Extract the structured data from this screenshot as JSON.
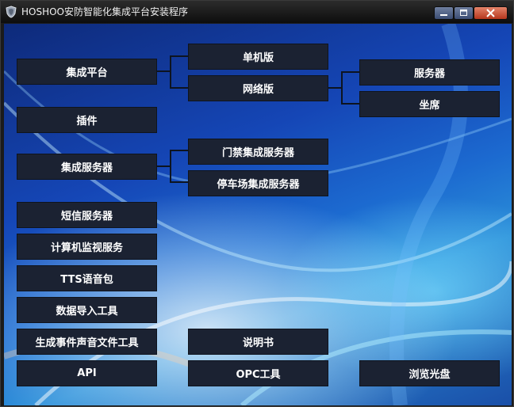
{
  "window": {
    "title": "HOSHOO安防智能化集成平台安装程序",
    "icon": "shield-icon"
  },
  "titlebar_buttons": [
    "minimize-icon",
    "maximize-icon",
    "close-icon"
  ],
  "buttons": {
    "jicheng_pingtai": "集成平台",
    "danjiban": "单机版",
    "wangluoban": "网络版",
    "fuwuqi": "服务器",
    "zuoxi": "坐席",
    "chajian": "插件",
    "jicheng_fuwuqi": "集成服务器",
    "menjin": "门禁集成服务器",
    "tingchechang": "停车场集成服务器",
    "duanxin": "短信服务器",
    "jisuanji_jianshi": "计算机监视服务",
    "tts": "TTS语音包",
    "shuju_daoru": "数据导入工具",
    "shengcheng_shijian": "生成事件声音文件工具",
    "shuomingshu": "说明书",
    "api": "API",
    "opc": "OPC工具",
    "liulan_guangpan": "浏览光盘"
  },
  "colors": {
    "button_bg": "#1b2232",
    "connector": "#0d1420",
    "close_button": "#c8452a"
  }
}
